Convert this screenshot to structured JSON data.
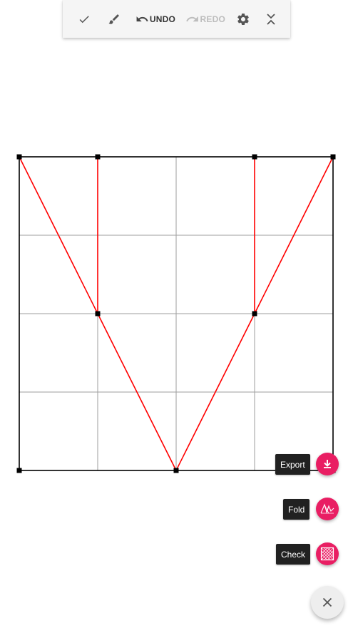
{
  "toolbar": {
    "confirm_icon": "check-icon",
    "brush_icon": "brush-icon",
    "undo_label": "UNDO",
    "redo_label": "REDO",
    "settings_icon": "gear-icon",
    "collapse_icon": "collapse-icon"
  },
  "speed_dial": {
    "export_label": "Export",
    "fold_label": "Fold",
    "check_label": "Check",
    "close_icon": "close-icon"
  },
  "colors": {
    "accent": "#e91e63",
    "mountain_crease": "#ff0000",
    "border": "#000000",
    "grid": "#9e9e9e",
    "toolbar_bg": "#f5f5f5"
  },
  "crease_pattern": {
    "grid_divisions": 4,
    "vertices": [
      [
        0,
        0
      ],
      [
        1,
        0
      ],
      [
        3,
        0
      ],
      [
        4,
        0
      ],
      [
        1,
        2
      ],
      [
        3,
        2
      ],
      [
        2,
        4
      ],
      [
        0,
        4
      ],
      [
        4,
        4
      ]
    ],
    "creases": [
      {
        "from": [
          0,
          0
        ],
        "to": [
          1,
          2
        ],
        "type": "mountain"
      },
      {
        "from": [
          1,
          0
        ],
        "to": [
          1,
          2
        ],
        "type": "mountain"
      },
      {
        "from": [
          1,
          2
        ],
        "to": [
          2,
          4
        ],
        "type": "mountain"
      },
      {
        "from": [
          4,
          0
        ],
        "to": [
          3,
          2
        ],
        "type": "mountain"
      },
      {
        "from": [
          3,
          0
        ],
        "to": [
          3,
          2
        ],
        "type": "mountain"
      },
      {
        "from": [
          3,
          2
        ],
        "to": [
          2,
          4
        ],
        "type": "mountain"
      }
    ]
  }
}
